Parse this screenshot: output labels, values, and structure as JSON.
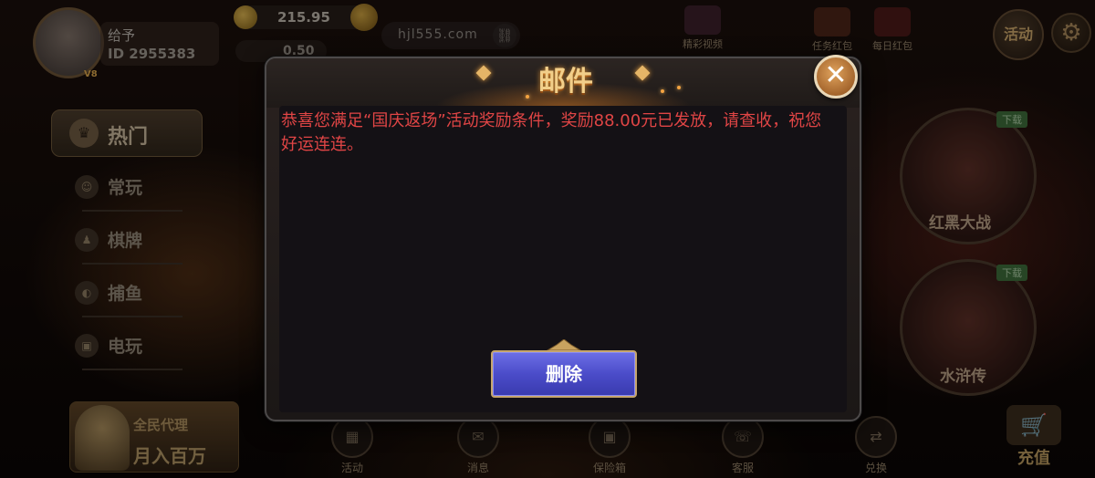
{
  "profile": {
    "nickname": "给予",
    "id_text": "ID 2955383",
    "vip": "V8"
  },
  "currency": {
    "coins": "215.95",
    "gems": "0.50"
  },
  "site_url": "hjl555.com",
  "top_right": {
    "video_label": "精彩视频",
    "task_label": "任务红包",
    "daily_label": "每日红包",
    "activity_label": "活动"
  },
  "left_menu": {
    "hot": "热门",
    "items": [
      "常玩",
      "棋牌",
      "捕鱼",
      "电玩"
    ]
  },
  "promo": {
    "line1": "全民代理",
    "line2": "月入百万"
  },
  "games": [
    {
      "name": "红黑大战",
      "badge": "下载"
    },
    {
      "name": "水浒传",
      "badge": "下载"
    }
  ],
  "bottom_nav": [
    "活动",
    "消息",
    "保险箱",
    "客服",
    "兑换"
  ],
  "recharge_label": "充值",
  "dialog": {
    "title": "邮件",
    "message": "恭喜您满足“国庆返场”活动奖励条件，奖励88.00元已发放，请查收，祝您好运连连。",
    "delete_label": "删除",
    "close_glyph": "✕"
  },
  "colors": {
    "message_text": "#e04545",
    "delete_button": "#4b4cc9",
    "title_glow": "#f2cf8a"
  }
}
